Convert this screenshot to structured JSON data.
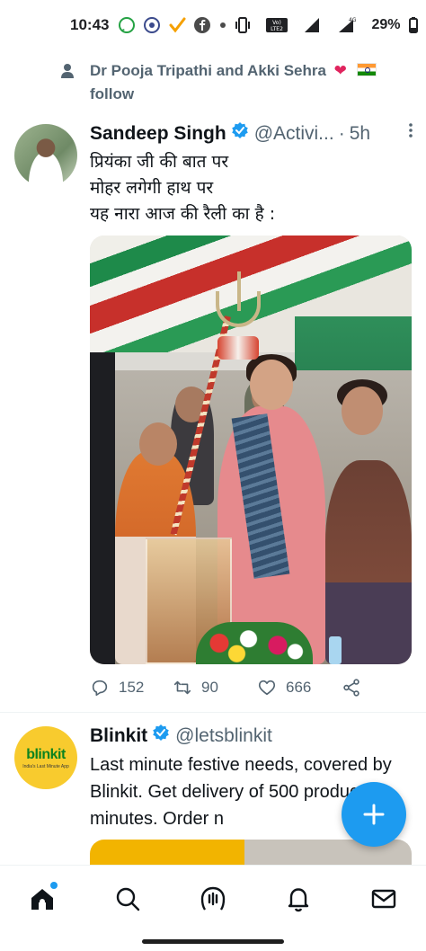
{
  "status_bar": {
    "time": "10:43",
    "battery": "29%",
    "network": "4G",
    "volte": "Vo) LTE2"
  },
  "social_context": {
    "text": "Dr Pooja Tripathi and Akki Sehra",
    "follow": "follow",
    "icon": "person-icon"
  },
  "tweets": [
    {
      "name": "Sandeep Singh",
      "handle": "@Activi...",
      "separator": "·",
      "time": "5h",
      "text_lines": [
        "प्रियंका जी की बात पर",
        "मोहर लगेगी हाथ पर",
        "यह नारा आज की रैली का है :"
      ],
      "replies": "152",
      "retweets": "90",
      "likes": "666"
    },
    {
      "name": "Blinkit",
      "handle": "@letsblinkit",
      "avatar_logo": "blinkit",
      "avatar_tagline": "India's Last Minute App",
      "text": "Last minute festive needs, covered by Blinkit. Get delivery of 500 products in minutes. Order n"
    }
  ],
  "colors": {
    "accent": "#1d9bf0",
    "secondary_text": "#536471",
    "heart": "#e0245e",
    "blinkit_yellow": "#f8cb2e",
    "blinkit_green": "#0c831f"
  },
  "nav": [
    "home-icon",
    "search-icon",
    "spaces-icon",
    "notifications-icon",
    "messages-icon"
  ]
}
